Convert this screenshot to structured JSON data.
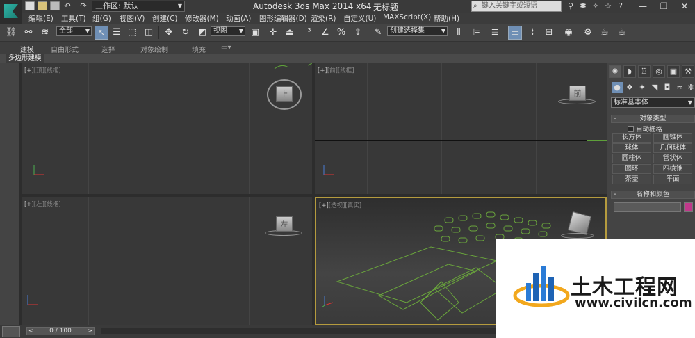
{
  "title_bar": {
    "workspace": "工作区: 默认",
    "app_title": "Autodesk 3ds Max  2014 x64",
    "doc_title": "无标题",
    "search_placeholder": "键入关键字或短语"
  },
  "menu": [
    "编辑(E)",
    "工具(T)",
    "组(G)",
    "视图(V)",
    "创建(C)",
    "修改器(M)",
    "动画(A)",
    "图形编辑器(D)",
    "渲染(R)",
    "自定义(U)",
    "MAXScript(X)",
    "帮助(H)"
  ],
  "toolbar": {
    "selection_filter": "全部",
    "ref_coord": "视图",
    "named_selection": "创建选择集"
  },
  "ribbon": {
    "tabs": [
      "建模",
      "自由形式",
      "选择",
      "对象绘制",
      "填充"
    ],
    "active_tab": "建模",
    "sub_tab": "多边形建模"
  },
  "viewports": {
    "top": {
      "plus": "[+]",
      "name": "[顶]",
      "mode": "[线框]",
      "cube": "上"
    },
    "front": {
      "plus": "[+]",
      "name": "[前]",
      "mode": "[线框]",
      "cube": "前"
    },
    "left": {
      "plus": "[+]",
      "name": "[左]",
      "mode": "[线框]",
      "cube": "左"
    },
    "perspective": {
      "plus": "[+]",
      "name": "[透视]",
      "mode": "[真实]"
    }
  },
  "command_panel": {
    "category": "标准基本体",
    "object_type_header": "对象类型",
    "autogrid": "自动栅格",
    "objects": [
      "长方体",
      "圆锥体",
      "球体",
      "几何球体",
      "圆柱体",
      "管状体",
      "圆环",
      "四棱锥",
      "茶壶",
      "平面"
    ],
    "name_color_header": "名称和颜色",
    "swatch_color": "#c0388a"
  },
  "time_slider": {
    "frame": "0 / 100"
  },
  "watermark": {
    "title": "土木工程网",
    "url": "www.civilcn.com"
  }
}
